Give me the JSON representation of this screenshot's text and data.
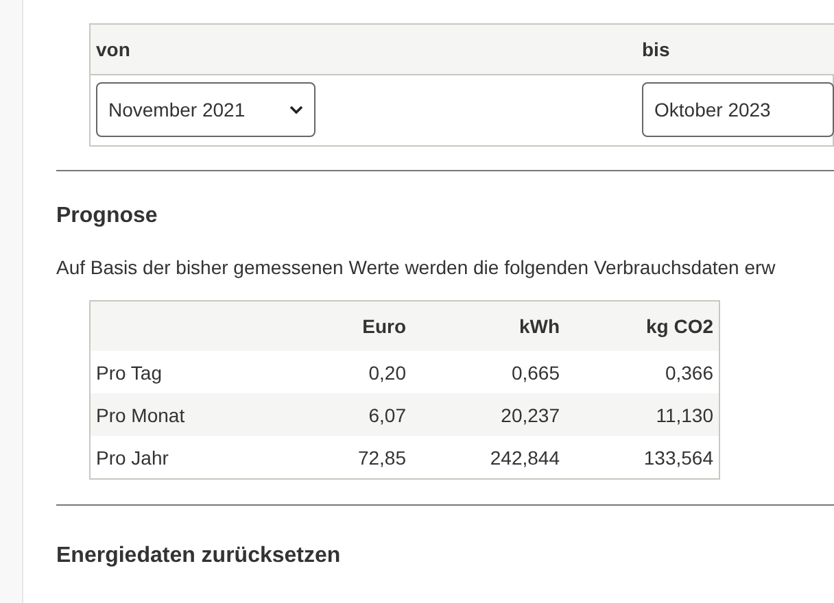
{
  "period": {
    "columns": [
      "von",
      "bis"
    ],
    "from": {
      "value": "November 2021"
    },
    "to": {
      "value": "Oktober 2023"
    }
  },
  "forecast": {
    "title": "Prognose",
    "intro": "Auf Basis der bisher gemessenen Werte werden die folgenden Verbrauchsdaten erw",
    "columns": [
      "Euro",
      "kWh",
      "kg CO2"
    ],
    "rows": [
      {
        "label": "Pro Tag",
        "values": [
          "0,20",
          "0,665",
          "0,366"
        ]
      },
      {
        "label": "Pro Monat",
        "values": [
          "6,07",
          "20,237",
          "11,130"
        ]
      },
      {
        "label": "Pro Jahr",
        "values": [
          "72,85",
          "242,844",
          "133,564"
        ]
      }
    ]
  },
  "reset": {
    "title": "Energiedaten zurücksetzen"
  }
}
